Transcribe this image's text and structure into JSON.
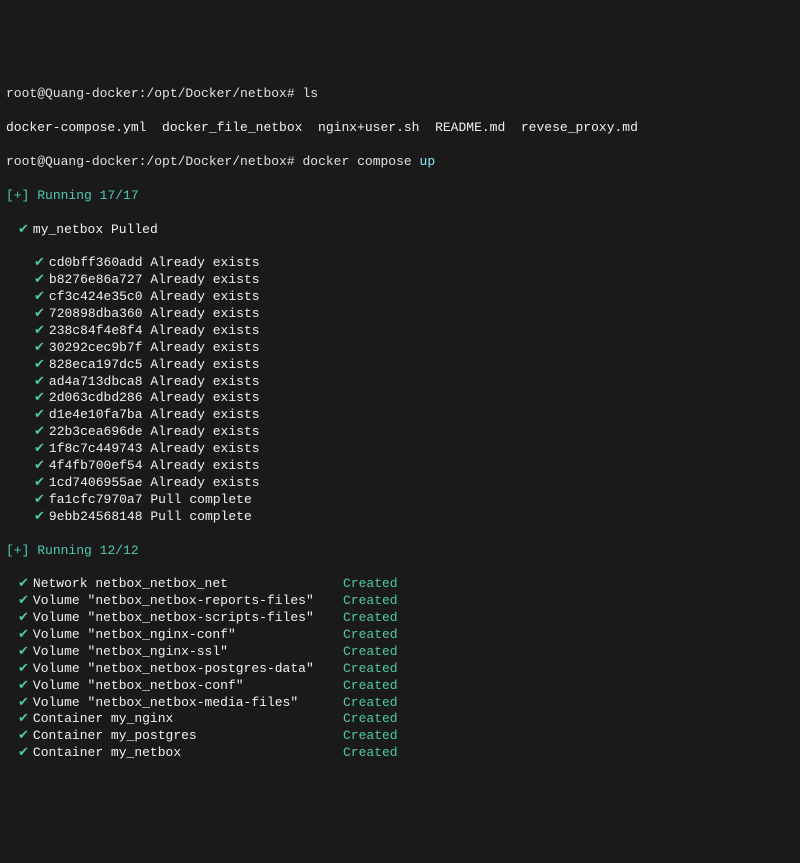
{
  "prompt1": {
    "user_host_path": "root@Quang-docker:/opt/Docker/netbox#",
    "command": "ls"
  },
  "ls_output": "docker-compose.yml  docker_file_netbox  nginx+user.sh  README.md  revese_proxy.md",
  "prompt2": {
    "user_host_path": "root@Quang-docker:/opt/Docker/netbox#",
    "cmd_part1": "docker",
    "cmd_part2": "compose",
    "cmd_part3": "up"
  },
  "running1": {
    "prefix": "[+]",
    "label": "Running",
    "count": "17/17"
  },
  "pulled": {
    "name": "my_netbox",
    "status": "Pulled"
  },
  "layers": [
    {
      "hash": "cd0bff360add",
      "status": "Already exists"
    },
    {
      "hash": "b8276e86a727",
      "status": "Already exists"
    },
    {
      "hash": "cf3c424e35c0",
      "status": "Already exists"
    },
    {
      "hash": "720898dba360",
      "status": "Already exists"
    },
    {
      "hash": "238c84f4e8f4",
      "status": "Already exists"
    },
    {
      "hash": "30292cec9b7f",
      "status": "Already exists"
    },
    {
      "hash": "828eca197dc5",
      "status": "Already exists"
    },
    {
      "hash": "ad4a713dbca8",
      "status": "Already exists"
    },
    {
      "hash": "2d063cdbd286",
      "status": "Already exists"
    },
    {
      "hash": "d1e4e10fa7ba",
      "status": "Already exists"
    },
    {
      "hash": "22b3cea696de",
      "status": "Already exists"
    },
    {
      "hash": "1f8c7c449743",
      "status": "Already exists"
    },
    {
      "hash": "4f4fb700ef54",
      "status": "Already exists"
    },
    {
      "hash": "1cd7406955ae",
      "status": "Already exists"
    },
    {
      "hash": "fa1cfc7970a7",
      "status": "Pull complete"
    },
    {
      "hash": "9ebb24568148",
      "status": "Pull complete"
    }
  ],
  "running2": {
    "prefix": "[+]",
    "label": "Running",
    "count": "12/12"
  },
  "resources": [
    {
      "name": "Network netbox_netbox_net",
      "status": "Created"
    },
    {
      "name": "Volume \"netbox_netbox-reports-files\"",
      "status": "Created"
    },
    {
      "name": "Volume \"netbox_netbox-scripts-files\"",
      "status": "Created"
    },
    {
      "name": "Volume \"netbox_nginx-conf\"",
      "status": "Created"
    },
    {
      "name": "Volume \"netbox_nginx-ssl\"",
      "status": "Created"
    },
    {
      "name": "Volume \"netbox_netbox-postgres-data\"",
      "status": "Created"
    },
    {
      "name": "Volume \"netbox_netbox-conf\"",
      "status": "Created"
    },
    {
      "name": "Volume \"netbox_netbox-media-files\"",
      "status": "Created"
    },
    {
      "name": "Container my_nginx",
      "status": "Created"
    },
    {
      "name": "Container my_postgres",
      "status": "Created"
    },
    {
      "name": "Container my_netbox",
      "status": "Created"
    }
  ]
}
